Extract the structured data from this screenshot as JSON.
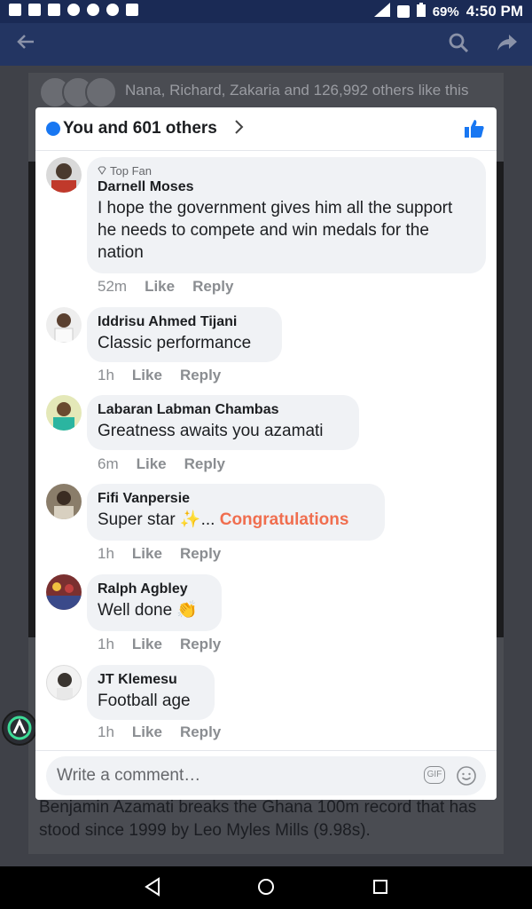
{
  "status_bar": {
    "battery": "69%",
    "time": "4:50 PM"
  },
  "background": {
    "likes_summary": "Nana, Richard, Zakaria and 126,992 others like this",
    "caption": "Benjamin Azamati breaks the Ghana 100m record that has stood since 1999 by Leo Myles Mills (9.98s)."
  },
  "reactions": {
    "title": "You and 601 others",
    "accent": "#1877f2"
  },
  "comments": [
    {
      "badge": "Top Fan",
      "name": "Darnell Moses",
      "text": "I hope the government gives him all the support he needs to compete and win medals for the nation",
      "time": "52m",
      "like": "Like",
      "reply": "Reply"
    },
    {
      "name": "Iddrisu Ahmed Tijani",
      "text": "Classic performance",
      "time": "1h",
      "like": "Like",
      "reply": "Reply"
    },
    {
      "name": "Labaran Labman Chambas",
      "text": "Greatness awaits you azamati",
      "time": "6m",
      "like": "Like",
      "reply": "Reply"
    },
    {
      "name": "Fifi Vanpersie",
      "text": "Super star ✨...",
      "highlight": "Congratulations",
      "time": "1h",
      "like": "Like",
      "reply": "Reply"
    },
    {
      "name": "Ralph Agbley",
      "text": "Well done 👏",
      "time": "1h",
      "like": "Like",
      "reply": "Reply"
    },
    {
      "name": "JT Klemesu",
      "text": "Football age",
      "time": "1h",
      "like": "Like",
      "reply": "Reply"
    }
  ],
  "composer": {
    "placeholder": "Write a comment…",
    "gif_label": "GIF"
  }
}
